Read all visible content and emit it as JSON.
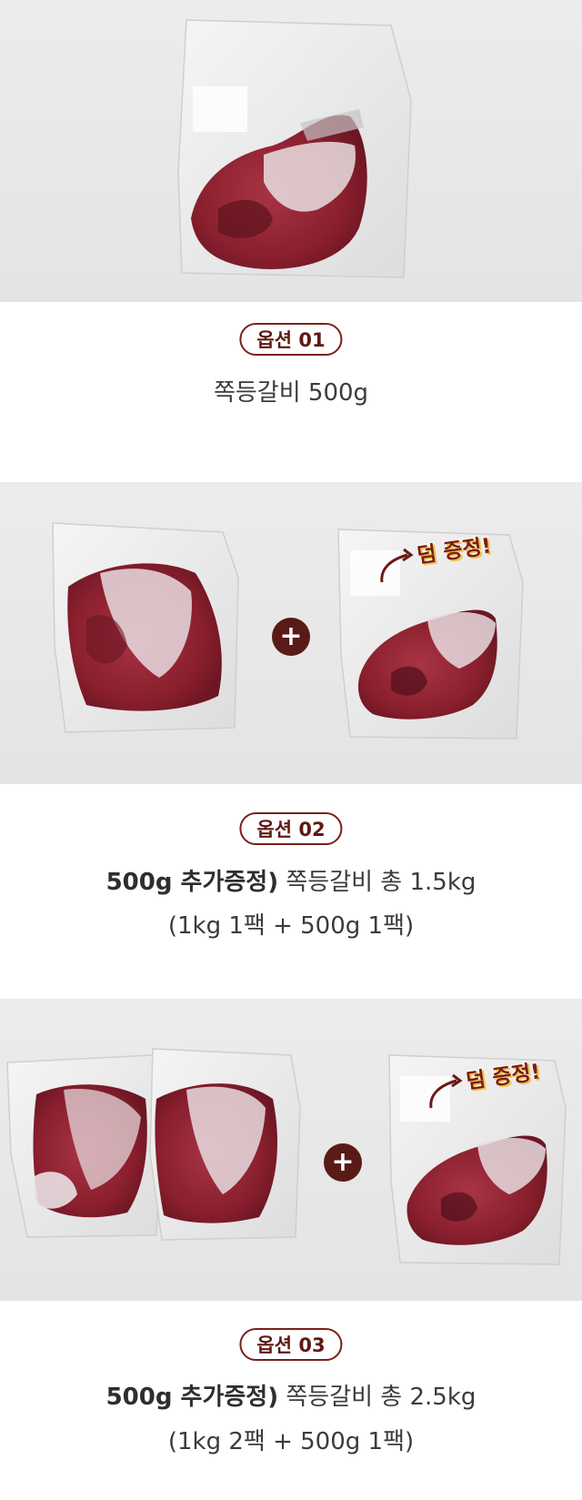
{
  "options": [
    {
      "badge": "옵션 01",
      "line1_bold": "",
      "line1_rest": "쪽등갈비 500g",
      "line2": ""
    },
    {
      "badge": "옵션 02",
      "line1_bold": "500g 추가증정)",
      "line1_rest": " 쪽등갈비 총 1.5kg",
      "line2": "(1kg 1팩 + 500g 1팩)"
    },
    {
      "badge": "옵션 03",
      "line1_bold": "500g 추가증정)",
      "line1_rest": " 쪽등갈비 총 2.5kg",
      "line2": "(1kg 2팩 + 500g 1팩)"
    }
  ],
  "gift_label": "덤 증정!",
  "plus_symbol": "+",
  "colors": {
    "accent": "#7a2018",
    "meat": "#8e2130",
    "photo_bg": "#e8e8e8"
  }
}
